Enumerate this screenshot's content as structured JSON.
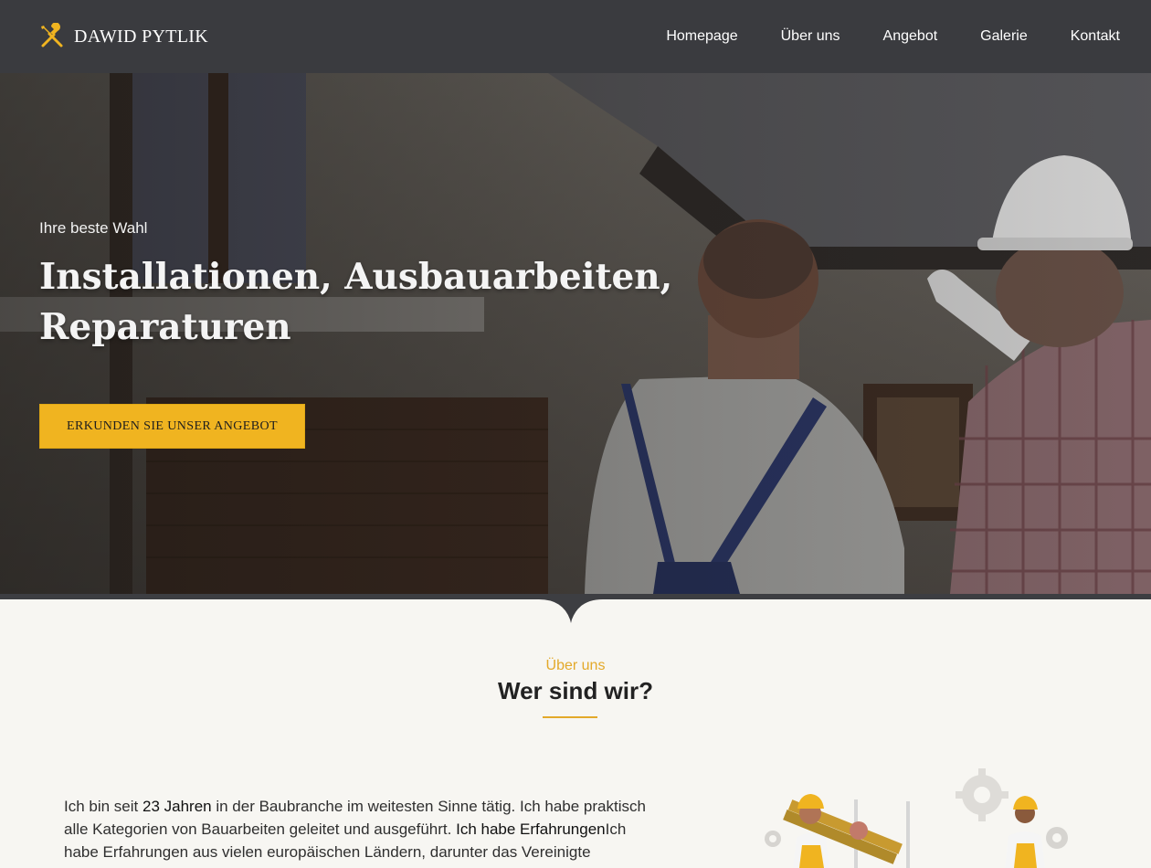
{
  "nav": {
    "brand": "DAWID PYTLIK",
    "brand_icon": "tools-icon",
    "items": [
      {
        "label": "Homepage"
      },
      {
        "label": "Über uns"
      },
      {
        "label": "Angebot"
      },
      {
        "label": "Galerie"
      },
      {
        "label": "Kontakt"
      }
    ]
  },
  "hero": {
    "tagline": "Ihre beste Wahl",
    "title": "Installationen, Ausbauarbeiten, Reparaturen",
    "cta": "ERKUNDEN SIE UNSER ANGEBOT"
  },
  "about": {
    "kicker": "Über uns",
    "title": "Wer sind wir?",
    "p_part1": "Ich bin seit ",
    "p_bold1": "23 Jahren",
    "p_part2": " in der Baubranche im weitesten Sinne tätig. Ich habe praktisch alle Kategorien von Bauarbeiten geleitet und ausgeführt. ",
    "p_bold2": "Ich habe Erfahrungen",
    "p_part3": "Ich habe Erfahrungen aus vielen europäischen Ländern, darunter das Vereinigte Königreich, Irland, die Niederlande, Deutschland, Polen und einige"
  },
  "colors": {
    "accent": "#f0b420",
    "nav_bg": "#3a3b3f",
    "page_bg": "#f7f6f2"
  }
}
